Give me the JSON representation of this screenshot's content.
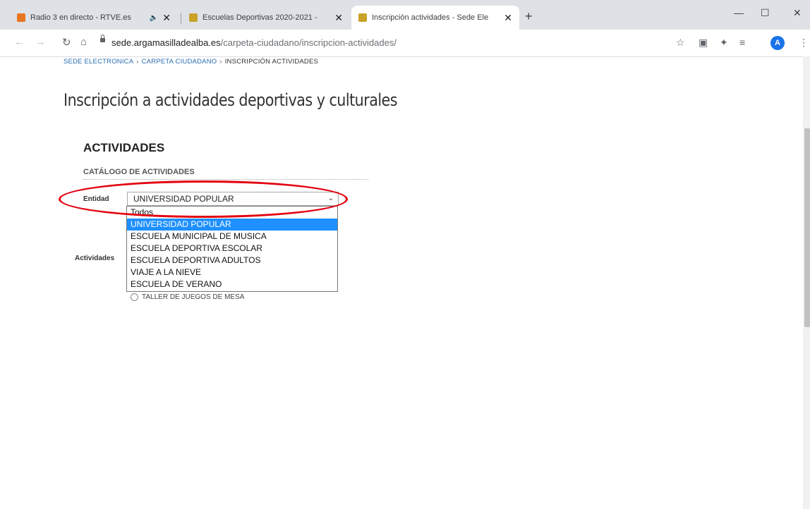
{
  "browser": {
    "tabs": [
      {
        "title": "Radio 3 en directo - RTVE.es",
        "active": false,
        "fav_color": "#e87722"
      },
      {
        "title": "Escuelas Deportivas 2020-2021 -",
        "active": false,
        "fav_color": "#c9a227"
      },
      {
        "title": "Inscripción actividades - Sede Ele",
        "active": true,
        "fav_color": "#c9a227"
      }
    ],
    "new_tab": "+",
    "close_glyph": "✕",
    "audio_glyph": "🔈",
    "url_domain": "sede.argamasilladealba.es",
    "url_path": "/carpeta-ciudadano/inscripcion-actividades/",
    "avatar_letter": "A",
    "controls": {
      "minimize": "—",
      "maximize": "☐",
      "close": "✕"
    }
  },
  "breadcrumb": {
    "items": [
      "SEDE ELECTRONICA",
      "CARPETA CIUDADANO",
      "INSCRIPCIÓN ACTIVIDADES"
    ],
    "separator": "›"
  },
  "page": {
    "title": "Inscripción a actividades deportivas y culturales",
    "section_title": "ACTIVIDADES",
    "subtitle": "CATÁLOGO DE ACTIVIDADES"
  },
  "form": {
    "entidad_label": "Entidad",
    "entidad_value": "UNIVERSIDAD POPULAR",
    "entidad_options": [
      "Todos",
      "UNIVERSIDAD POPULAR",
      "ESCUELA MUNICIPAL DE MUSICA",
      "ESCUELA DEPORTIVA ESCOLAR",
      "ESCUELA DEPORTIVA ADULTOS",
      "VIAJE A LA NIEVE",
      "ESCUELA DE VERANO"
    ],
    "entidad_selected_index": 1,
    "actividades_label": "Actividades",
    "actividades_visible": [
      "TALLER DE JUEGOS DE MESA"
    ]
  },
  "colors": {
    "accent": "#1e90ff",
    "annotation": "#e3000f",
    "link": "#2a6db0"
  }
}
